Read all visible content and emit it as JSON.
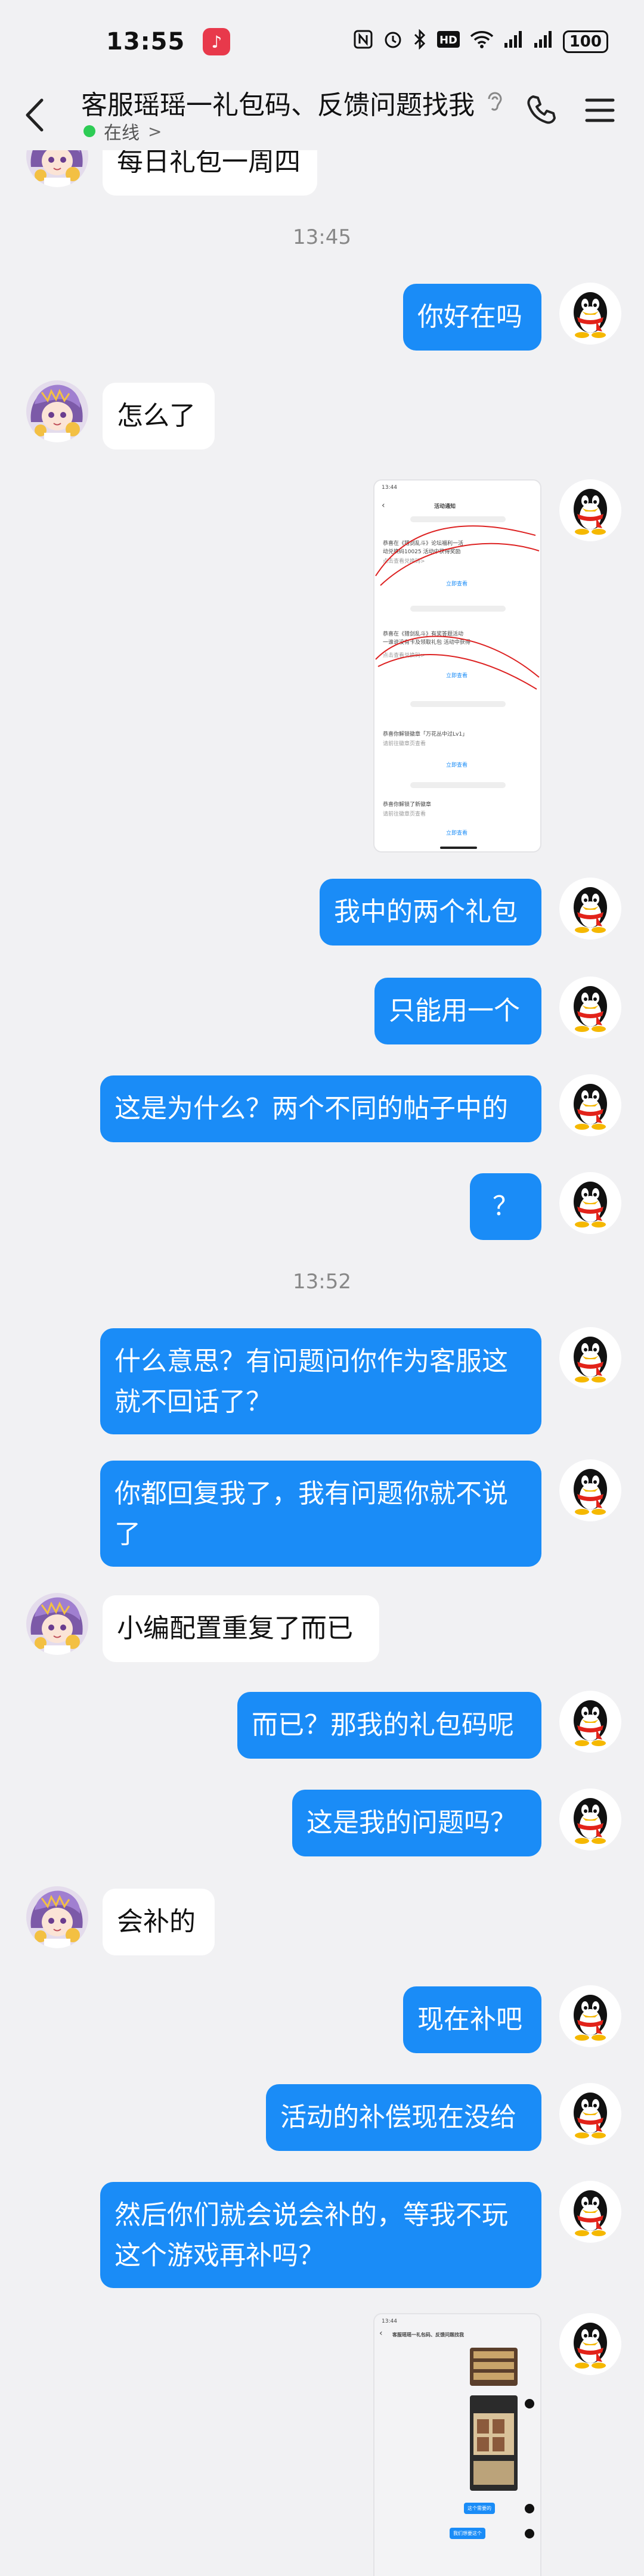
{
  "status_bar": {
    "time": "13:55",
    "battery": "100"
  },
  "header": {
    "title": "客服瑶瑶一礼包码、反馈问题找我",
    "status": "在线",
    "status_chevron": ">"
  },
  "messages": {
    "m0": "每日礼包一周四",
    "t1": "13:45",
    "m1": "你好在吗",
    "m2": "怎么了",
    "m3": "我中的两个礼包",
    "m4": "只能用一个",
    "m5": "这是为什么？两个不同的帖子中的",
    "m6": "？",
    "t2": "13:52",
    "m7a": "什么意思？有问题问你作为客服这",
    "m7b": "就不回话了？",
    "m8a": "你都回复我了，我有问题你就不说",
    "m8b": "了",
    "m9": "小编配置重复了而已",
    "m10": "而已？那我的礼包码呢",
    "m11": "这是我的问题吗？",
    "m12": "会补的",
    "m13": "现在补吧",
    "m14": "活动的补偿现在没给",
    "m15a": "然后你们就会说会补的，等我不玩",
    "m15b": "这个游戏再补吗？"
  },
  "screenshot1": {
    "time": "13:44",
    "title": "活动通知",
    "line_a1": "恭喜在《猎剑乱斗》论坛福利一活",
    "line_a2": "动兑换码10025 活动中获得奖励",
    "line_a3": "点击查看兑换码>",
    "link_a": "立即查看",
    "line_b1": "恭喜在《猎剑乱斗》有奖答题活动",
    "line_b2": "一谁说没有卡及领取礼包 活动中获得",
    "line_b3": "点击查看兑换码>",
    "link_b": "立即查看",
    "line_c1": "恭喜你解锁徽章「万花丛中过Lv1」",
    "line_c2": "请前往徽章页查看",
    "link_c": "立即查看",
    "line_d1": "恭喜你解锁了新徽章",
    "line_d2": "请前往徽章页查看",
    "link_d": "立即查看"
  },
  "screenshot2": {
    "time": "13:44",
    "title": "客服瑶瑶一礼包码、反馈问题找我",
    "bubble1": "这个需要的",
    "bubble2": "我们想要这个"
  },
  "colors": {
    "bubble_out": "#1a8cf7",
    "bubble_in": "#ffffff",
    "background": "#f1f1f3",
    "online": "#2ecc55"
  },
  "icons": {
    "back": "back-chevron-icon",
    "ear": "ear-icon",
    "phone": "phone-icon",
    "menu": "menu-icon"
  }
}
